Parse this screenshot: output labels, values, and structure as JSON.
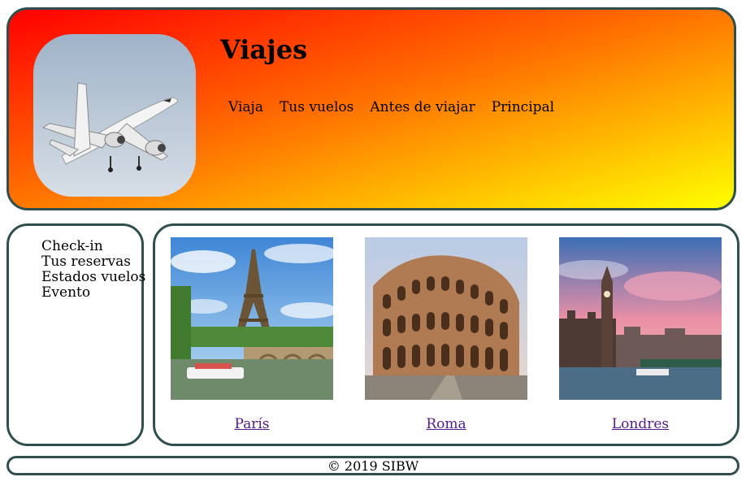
{
  "header": {
    "title": "Viajes",
    "logo_icon": "airplane-icon",
    "nav": [
      {
        "label": "Viaja"
      },
      {
        "label": "Tus vuelos"
      },
      {
        "label": "Antes de viajar"
      },
      {
        "label": "Principal"
      }
    ]
  },
  "sidebar": {
    "items": [
      {
        "label": "Check-in"
      },
      {
        "label": "Tus reservas"
      },
      {
        "label": "Estados vuelos"
      },
      {
        "label": "Evento"
      }
    ]
  },
  "destinations": [
    {
      "label": "París",
      "image": "eiffel-tower-photo"
    },
    {
      "label": "Roma",
      "image": "colosseum-photo"
    },
    {
      "label": "Londres",
      "image": "big-ben-photo"
    }
  ],
  "footer": {
    "text": "© 2019 SIBW"
  },
  "colors": {
    "border": "#2f4f4f",
    "gradient_start": "#ff0000",
    "gradient_end": "#ffff00",
    "link": "#551a8b"
  }
}
